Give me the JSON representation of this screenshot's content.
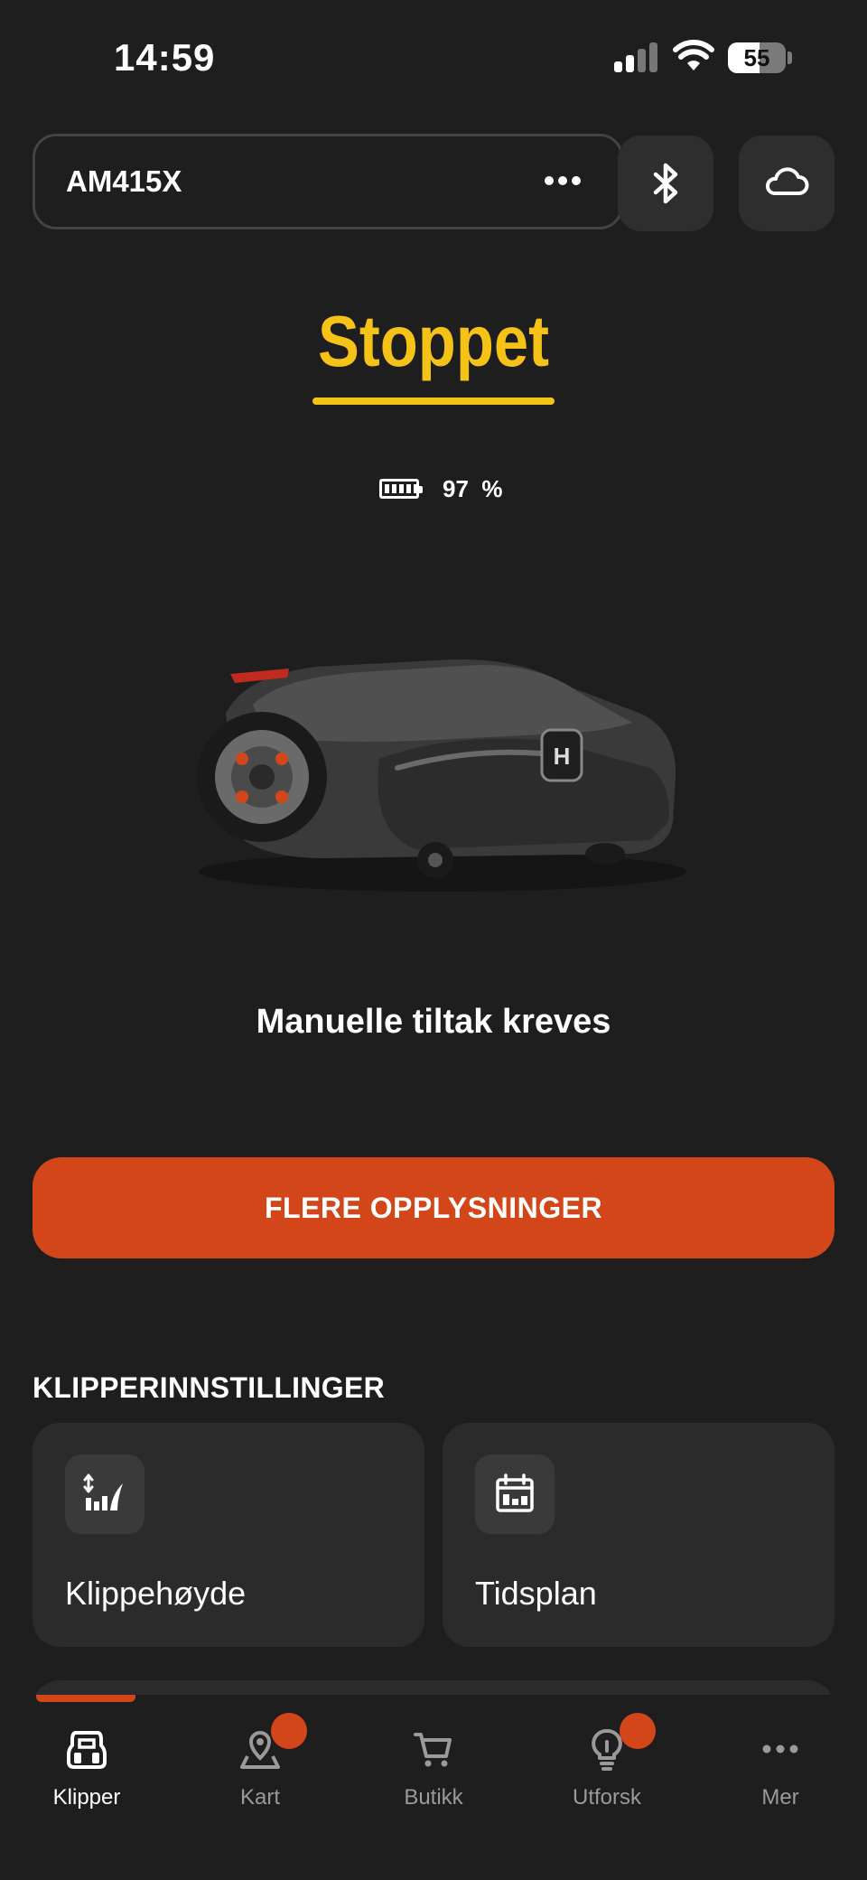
{
  "status_bar": {
    "time": "14:59",
    "battery_level": "55"
  },
  "header": {
    "mower_name": "AM415X",
    "more_icon": "more-horizontal-icon",
    "bluetooth_icon": "bluetooth-icon",
    "cloud_icon": "cloud-icon"
  },
  "mower_status": {
    "title": "Stoppet",
    "battery_value": "97",
    "battery_unit": "%",
    "message": "Manuelle tiltak kreves"
  },
  "cta": {
    "label": "FLERE OPPLYSNINGER"
  },
  "settings": {
    "heading": "KLIPPERINNSTILLINGER",
    "cards": [
      {
        "label": "Klippehøyde",
        "icon": "cutting-height-icon"
      },
      {
        "label": "Tidsplan",
        "icon": "calendar-icon"
      }
    ]
  },
  "tabs": [
    {
      "label": "Klipper",
      "icon": "mower-icon",
      "active": true,
      "badge": false
    },
    {
      "label": "Kart",
      "icon": "map-pin-icon",
      "active": false,
      "badge": true
    },
    {
      "label": "Butikk",
      "icon": "cart-icon",
      "active": false,
      "badge": false
    },
    {
      "label": "Utforsk",
      "icon": "lightbulb-icon",
      "active": false,
      "badge": true
    },
    {
      "label": "Mer",
      "icon": "more-horizontal-icon",
      "active": false,
      "badge": false
    }
  ],
  "colors": {
    "background": "#1e1e1e",
    "accent_orange": "#d2461a",
    "status_yellow": "#f5c218",
    "card": "#2b2b2b"
  }
}
